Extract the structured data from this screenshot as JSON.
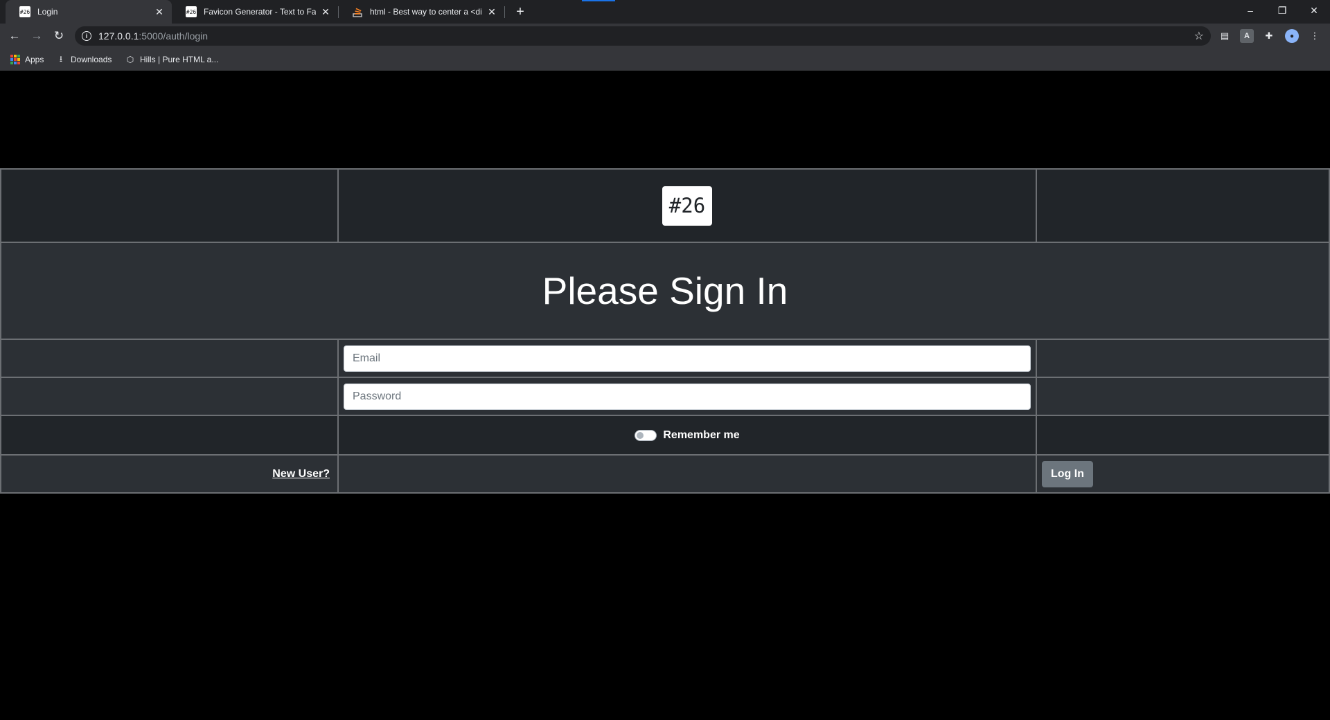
{
  "browser": {
    "tabs": [
      {
        "favicon": "#26",
        "title": "Login",
        "active": true
      },
      {
        "favicon": "#26",
        "title": "Favicon Generator - Text to Favic",
        "active": false
      },
      {
        "favicon": "stackoverflow-icon",
        "title": "html - Best way to center a <div",
        "active": false
      }
    ],
    "newtab": "+",
    "window_controls": {
      "minimize": "–",
      "restore": "❐",
      "close": "✕"
    },
    "url_host": "127.0.0.1",
    "url_path": ":5000/auth/login",
    "bookmarks": [
      {
        "icon": "apps-grid-icon",
        "label": "Apps"
      },
      {
        "icon": "download-icon",
        "label": "Downloads"
      },
      {
        "icon": "hills-logo-icon",
        "label": "Hills | Pure HTML a..."
      }
    ]
  },
  "page": {
    "logo_text": "#26",
    "heading": "Please Sign In",
    "email_placeholder": "Email",
    "password_placeholder": "Password",
    "remember_label": "Remember me",
    "remember_checked": false,
    "new_user_link": "New User?",
    "login_button": "Log In"
  },
  "colors": {
    "chrome_dark": "#202124",
    "chrome_toolbar": "#35363a",
    "row_dark": "#212529",
    "row_light": "#2c3035",
    "button_secondary": "#6c757d"
  }
}
